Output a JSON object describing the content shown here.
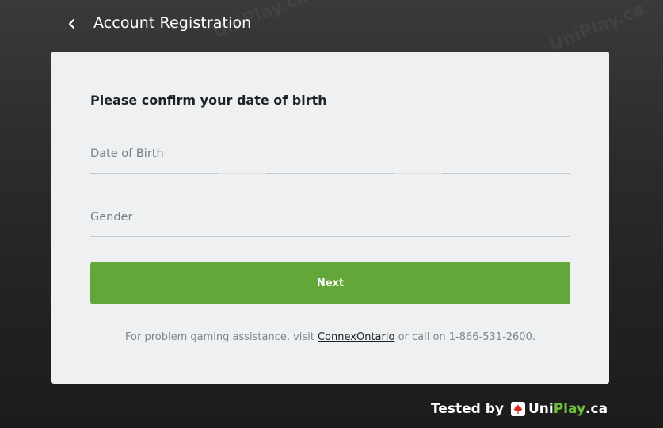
{
  "header": {
    "back_icon": "chevron-left-icon",
    "title": "Account Registration"
  },
  "watermark": {
    "text": "UniPlay.ca"
  },
  "form": {
    "heading": "Please confirm your date of birth",
    "dob_label": "Date of Birth",
    "gender_label": "Gender",
    "next_label": "Next"
  },
  "footer": {
    "help_prefix": "For problem gaming assistance, visit ",
    "help_link": "ConnexOntario",
    "help_suffix": " or call on 1-866-531-2600."
  },
  "brand": {
    "tested_by": "Tested by",
    "uni": "Uni",
    "play": "Play",
    "tld": ".ca",
    "flag_icon": "maple-leaf-icon"
  },
  "colors": {
    "accent": "#63a63a",
    "card_background": "#eef0f1",
    "page_background": "#2a2a2a"
  }
}
